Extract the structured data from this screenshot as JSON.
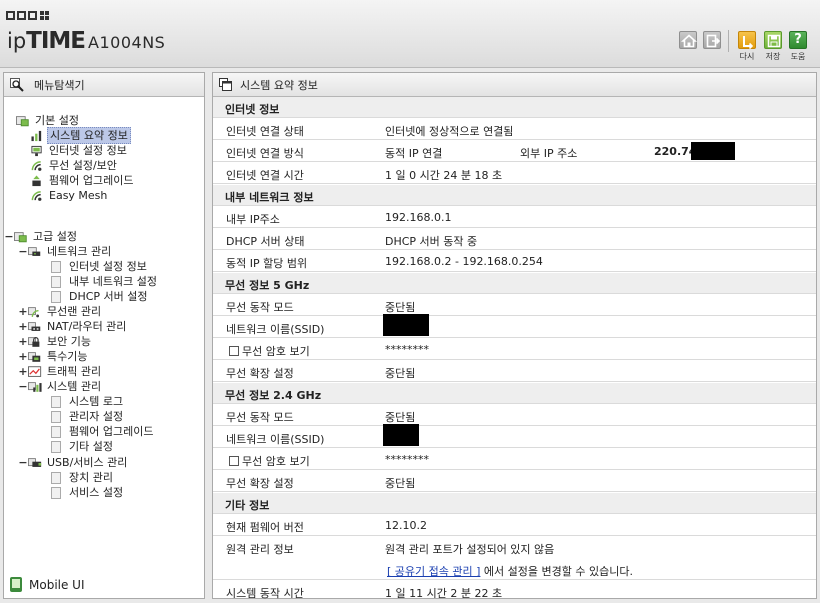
{
  "header": {
    "logo_ip": "ip",
    "logo_time": "TIME",
    "model": "A1004NS",
    "buttons": {
      "restart_label": "다시",
      "save_label": "저장",
      "help_label": "도움",
      "help_glyph": "?"
    }
  },
  "sidebar": {
    "title": "메뉴탐색기",
    "basic": {
      "label": "기본 설정",
      "items": [
        "시스템 요약 정보",
        "인터넷 설정 정보",
        "무선 설정/보안",
        "펌웨어 업그레이드",
        "Easy Mesh"
      ]
    },
    "advanced": {
      "label": "고급 설정",
      "toggle": "−",
      "network": {
        "label": "네트워크 관리",
        "toggle": "−",
        "items": [
          "인터넷 설정 정보",
          "내부 네트워크 설정",
          "DHCP 서버 설정"
        ]
      },
      "collapsed": [
        {
          "label": "무선랜 관리",
          "toggle": "+"
        },
        {
          "label": "NAT/라우터 관리",
          "toggle": "+"
        },
        {
          "label": "보안 기능",
          "toggle": "+"
        },
        {
          "label": "특수기능",
          "toggle": "+"
        },
        {
          "label": "트래픽 관리",
          "toggle": "+"
        }
      ],
      "system": {
        "label": "시스템 관리",
        "toggle": "−",
        "items": [
          "시스템 로그",
          "관리자 설정",
          "펌웨어 업그레이드",
          "기타 설정"
        ]
      },
      "usb": {
        "label": "USB/서비스 관리",
        "toggle": "−",
        "items": [
          "장치 관리",
          "서비스 설정"
        ]
      }
    },
    "mobile_ui": "Mobile UI"
  },
  "main": {
    "title": "시스템 요약 정보",
    "internet": {
      "section": "인터넷 정보",
      "status_label": "인터넷 연결 상태",
      "status_value": "인터넷에 정상적으로 연결됨",
      "method_label": "인터넷 연결 방식",
      "method_value": "동적 IP 연결",
      "external_ip_label": "외부 IP 주소",
      "external_ip_value": "220.74",
      "time_label": "인터넷 연결 시간",
      "time_value": "1 일 0 시간 24 분 18 초"
    },
    "lan": {
      "section": "내부 네트워크 정보",
      "ip_label": "내부 IP주소",
      "ip_value": "192.168.0.1",
      "dhcp_label": "DHCP 서버 상태",
      "dhcp_value": "DHCP 서버 동작 중",
      "range_label": "동적 IP 할당 범위",
      "range_value": "192.168.0.2 -  192.168.0.254"
    },
    "wifi5": {
      "section": "무선 정보 5 GHz",
      "mode_label": "무선 동작 모드",
      "mode_value": "중단됨",
      "ssid_label": "네트워크 이름(SSID)",
      "password_label": "무선 암호 보기",
      "password_value": "********",
      "ext_label": "무선 확장 설정",
      "ext_value": "중단됨"
    },
    "wifi24": {
      "section": "무선 정보 2.4 GHz",
      "mode_label": "무선 동작 모드",
      "mode_value": "중단됨",
      "ssid_label": "네트워크 이름(SSID)",
      "password_label": "무선 암호 보기",
      "password_value": "********",
      "ext_label": "무선 확장 설정",
      "ext_value": "중단됨"
    },
    "other": {
      "section": "기타 정보",
      "fw_label": "현재 펌웨어 버전",
      "fw_value": "12.10.2",
      "remote_label": "원격 관리 정보",
      "remote_value": "원격 관리 포트가 설정되어 있지 않음",
      "remote_link": "[ 공유기 접속 관리 ]",
      "remote_link_suffix": " 에서 설정을 변경할 수 있습니다.",
      "uptime_label": "시스템 동작 시간",
      "uptime_value": "1 일 11 시간 2 분 22 초"
    }
  },
  "colors": {
    "section_bg": "#eeeeee",
    "selected_bg": "#bcc8e8",
    "restart": "#f0b22c",
    "save": "#8cc651",
    "help": "#3f9e3f",
    "link": "#1a3fb0"
  }
}
